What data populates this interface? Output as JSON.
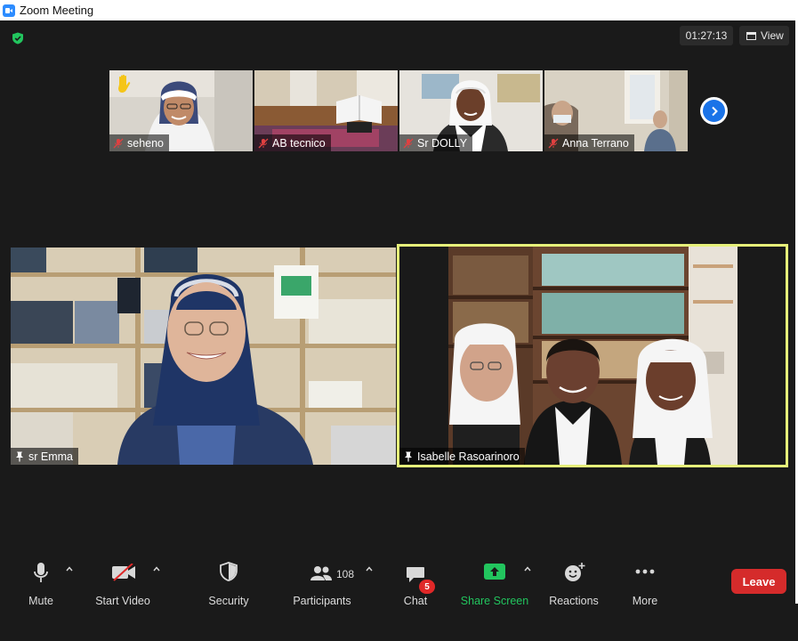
{
  "window": {
    "title": "Zoom Meeting"
  },
  "header": {
    "timer": "01:27:13",
    "view_label": "View"
  },
  "thumbnails": [
    {
      "name": "seheno",
      "raised_hand": true
    },
    {
      "name": "AB tecnico"
    },
    {
      "name": "Sr DOLLY"
    },
    {
      "name": "Anna Terrano"
    }
  ],
  "tiles": {
    "left": {
      "name": "sr Emma"
    },
    "right": {
      "name": "Isabelle Rasoarinoro",
      "active_speaker": true
    }
  },
  "toolbar": {
    "mute": "Mute",
    "start_video": "Start Video",
    "security": "Security",
    "participants": "Participants",
    "participants_count": "108",
    "chat": "Chat",
    "chat_badge": "5",
    "share_screen": "Share Screen",
    "reactions": "Reactions",
    "more": "More",
    "leave": "Leave"
  },
  "colors": {
    "background": "#1a1a1a",
    "active_speaker_border": "#e6f07a",
    "share_green": "#22c55e",
    "leave_red": "#d52b2b",
    "accent_blue": "#1a73e8"
  }
}
